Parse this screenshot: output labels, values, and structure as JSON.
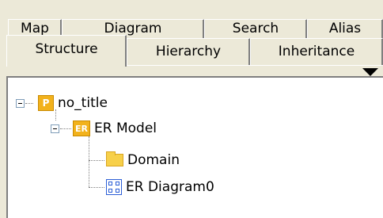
{
  "tabs_back": [
    {
      "label": "Map"
    },
    {
      "label": "Diagram"
    },
    {
      "label": "Search"
    },
    {
      "label": "Alias"
    }
  ],
  "tabs_front": [
    {
      "label": "Structure",
      "active": true
    },
    {
      "label": "Hierarchy",
      "active": false
    },
    {
      "label": "Inheritance",
      "active": false
    }
  ],
  "tree": {
    "root": {
      "label": "no_title",
      "icon": "project-icon",
      "icon_text": "P"
    },
    "model": {
      "label": "ER Model",
      "icon": "er-model-icon",
      "icon_text": "ER"
    },
    "domain": {
      "label": "Domain",
      "icon": "folder-icon"
    },
    "diagram": {
      "label": "ER Diagram0",
      "icon": "er-diagram-icon"
    }
  },
  "colors": {
    "panel_bg": "#ece9d8",
    "tree_bg": "#ffffff",
    "icon_orange": "#f2b21c",
    "folder_yellow": "#f7d04a",
    "diagram_blue": "#2b5ed6"
  }
}
